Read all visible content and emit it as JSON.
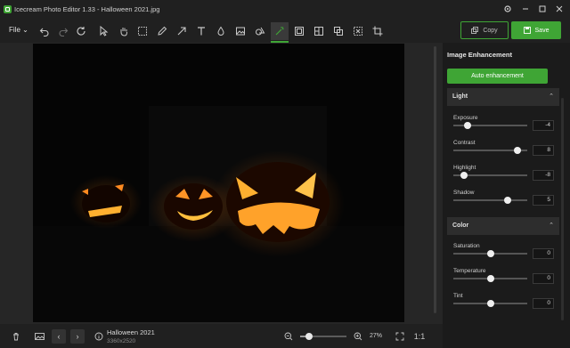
{
  "window": {
    "title": "Icecream Photo Editor 1.33 - Halloween  2021.jpg",
    "controls": [
      "gear-icon",
      "minimize-icon",
      "maximize-icon",
      "close-icon"
    ]
  },
  "toolbar": {
    "file_label": "File",
    "tools": [
      "undo-icon",
      "redo-icon",
      "refresh-icon",
      "pointer-icon",
      "hand-icon",
      "marquee-icon",
      "pencil-icon",
      "arrow-icon",
      "text-icon",
      "drop-icon",
      "image-icon",
      "shape-icon",
      "magic-wand-icon",
      "frame-icon",
      "collage-icon",
      "layers-icon",
      "select-icon",
      "crop-icon"
    ],
    "active_tool": "magic-wand-icon",
    "copy_label": "Copy",
    "save_label": "Save"
  },
  "panel": {
    "title": "Image Enhancement",
    "auto_label": "Auto enhancement",
    "sections": {
      "light": {
        "label": "Light"
      },
      "color": {
        "label": "Color"
      }
    },
    "light": [
      {
        "label": "Exposure",
        "value": "-4",
        "level": 0.19
      },
      {
        "label": "Contrast",
        "value": "8",
        "level": 0.87
      },
      {
        "label": "Highlight",
        "value": "-8",
        "level": 0.14
      },
      {
        "label": "Shadow",
        "value": "5",
        "level": 0.73
      }
    ],
    "color": [
      {
        "label": "Saturation",
        "value": "0",
        "level": 0.5
      },
      {
        "label": "Temperature",
        "value": "0",
        "level": 0.5
      },
      {
        "label": "Tint",
        "value": "0",
        "level": 0.5
      }
    ]
  },
  "status": {
    "file_name": "Halloween  2021",
    "dimensions": "3360x2520",
    "zoom": "27%",
    "zoom_level": 0.2,
    "one_to_one": "1:1"
  },
  "colors": {
    "accent": "#3fa535",
    "background": "#1f1f1f",
    "panel": "#1b1b1b"
  }
}
